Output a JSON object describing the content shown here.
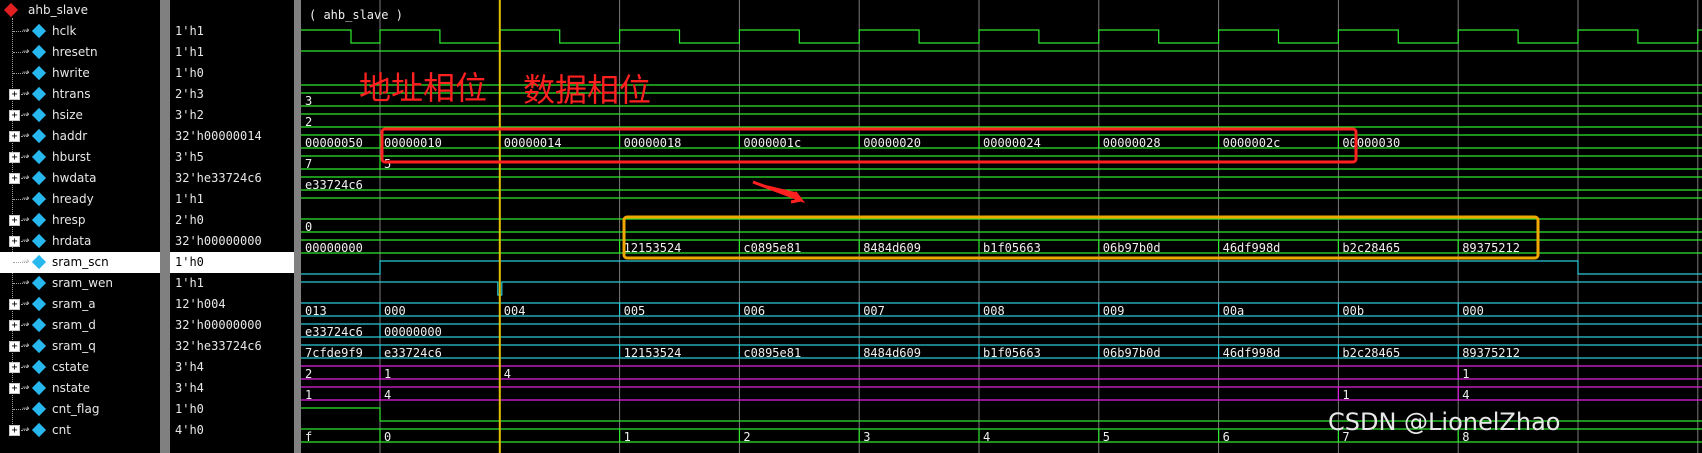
{
  "waveform_window": {
    "group": {
      "name": "ahb_slave",
      "cursor_label": "( ahb_slave )"
    },
    "signals": [
      {
        "name": "hclk",
        "value": "1'h1",
        "bus": false
      },
      {
        "name": "hresetn",
        "value": "1'h1",
        "bus": false
      },
      {
        "name": "hwrite",
        "value": "1'h0",
        "bus": false
      },
      {
        "name": "htrans",
        "value": "2'h3",
        "bus": true
      },
      {
        "name": "hsize",
        "value": "3'h2",
        "bus": true
      },
      {
        "name": "haddr",
        "value": "32'h00000014",
        "bus": true
      },
      {
        "name": "hburst",
        "value": "3'h5",
        "bus": true
      },
      {
        "name": "hwdata",
        "value": "32'he33724c6",
        "bus": true
      },
      {
        "name": "hready",
        "value": "1'h1",
        "bus": false
      },
      {
        "name": "hresp",
        "value": "2'h0",
        "bus": true
      },
      {
        "name": "hrdata",
        "value": "32'h00000000",
        "bus": true
      },
      {
        "name": "sram_scn",
        "value": "1'h0",
        "bus": false,
        "selected": true
      },
      {
        "name": "sram_wen",
        "value": "1'h1",
        "bus": false
      },
      {
        "name": "sram_a",
        "value": "12'h004",
        "bus": true
      },
      {
        "name": "sram_d",
        "value": "32'h00000000",
        "bus": true
      },
      {
        "name": "sram_q",
        "value": "32'he33724c6",
        "bus": true
      },
      {
        "name": "cstate",
        "value": "3'h4",
        "bus": true
      },
      {
        "name": "nstate",
        "value": "3'h4",
        "bus": true
      },
      {
        "name": "cnt_flag",
        "value": "1'h0",
        "bus": false
      },
      {
        "name": "cnt",
        "value": "4'h0",
        "bus": true
      }
    ],
    "bus_waves": {
      "htrans": [
        "3"
      ],
      "hsize": [
        "2"
      ],
      "haddr": [
        "00000050",
        "00000010",
        "00000014",
        "00000018",
        "0000001c",
        "00000020",
        "00000024",
        "00000028",
        "0000002c",
        "00000030"
      ],
      "hburst": [
        "7",
        "5"
      ],
      "hwdata": [
        "e33724c6"
      ],
      "hresp": [
        "0"
      ],
      "hrdata": [
        "00000000",
        "12153524",
        "c0895e81",
        "8484d609",
        "b1f05663",
        "06b97b0d",
        "46df998d",
        "b2c28465",
        "89375212"
      ],
      "sram_a": [
        "013",
        "000",
        "004",
        "005",
        "006",
        "007",
        "008",
        "009",
        "00a",
        "00b",
        "000"
      ],
      "sram_d": [
        "e33724c6",
        "00000000"
      ],
      "sram_q": [
        "7cfde9f9",
        "e33724c6",
        "12153524",
        "c0895e81",
        "8484d609",
        "b1f05663",
        "06b97b0d",
        "46df998d",
        "b2c28465",
        "89375212"
      ],
      "cstate": [
        "2",
        "1",
        "4",
        "1"
      ],
      "nstate": [
        "1",
        "4",
        "1",
        "4"
      ],
      "cnt": [
        "f",
        "0",
        "1",
        "2",
        "3",
        "4",
        "5",
        "6",
        "7",
        "8"
      ]
    },
    "annotations": {
      "address_phase": "地址相位",
      "data_phase": "数据相位",
      "watermark": "CSDN @LionelZhao"
    },
    "colors": {
      "background": "#000000",
      "wave_green": "#2ee82e",
      "wave_cyan": "#29c9d9",
      "wave_magenta": "#e020e0",
      "grid": "#7a7a7a",
      "cursor": "#e0c000",
      "annotation_red": "#ff2020",
      "annotation_orange": "#f0a800"
    }
  }
}
